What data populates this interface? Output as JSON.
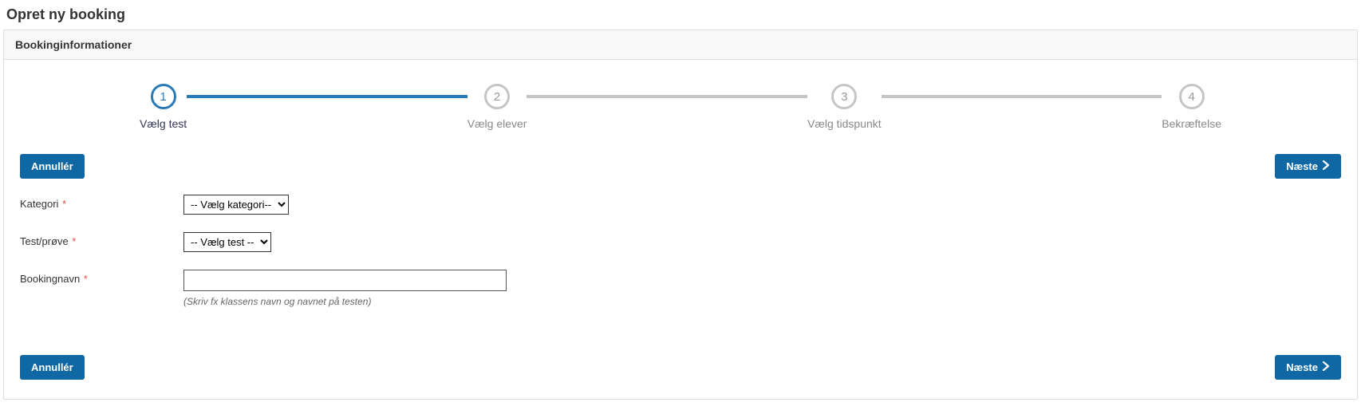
{
  "page": {
    "title": "Opret ny booking"
  },
  "panel": {
    "title": "Bookinginformationer"
  },
  "stepper": {
    "steps": [
      {
        "num": "1",
        "label": "Vælg test"
      },
      {
        "num": "2",
        "label": "Vælg elever"
      },
      {
        "num": "3",
        "label": "Vælg tidspunkt"
      },
      {
        "num": "4",
        "label": "Bekræftelse"
      }
    ]
  },
  "buttons": {
    "cancel": "Annullér",
    "next": "Næste"
  },
  "form": {
    "category": {
      "label": "Kategori",
      "selected": "-- Vælg kategori--"
    },
    "test": {
      "label": "Test/prøve",
      "selected": "-- Vælg test --"
    },
    "bookingName": {
      "label": "Bookingnavn",
      "value": "",
      "hint": "(Skriv fx klassens navn og navnet på testen)"
    }
  }
}
